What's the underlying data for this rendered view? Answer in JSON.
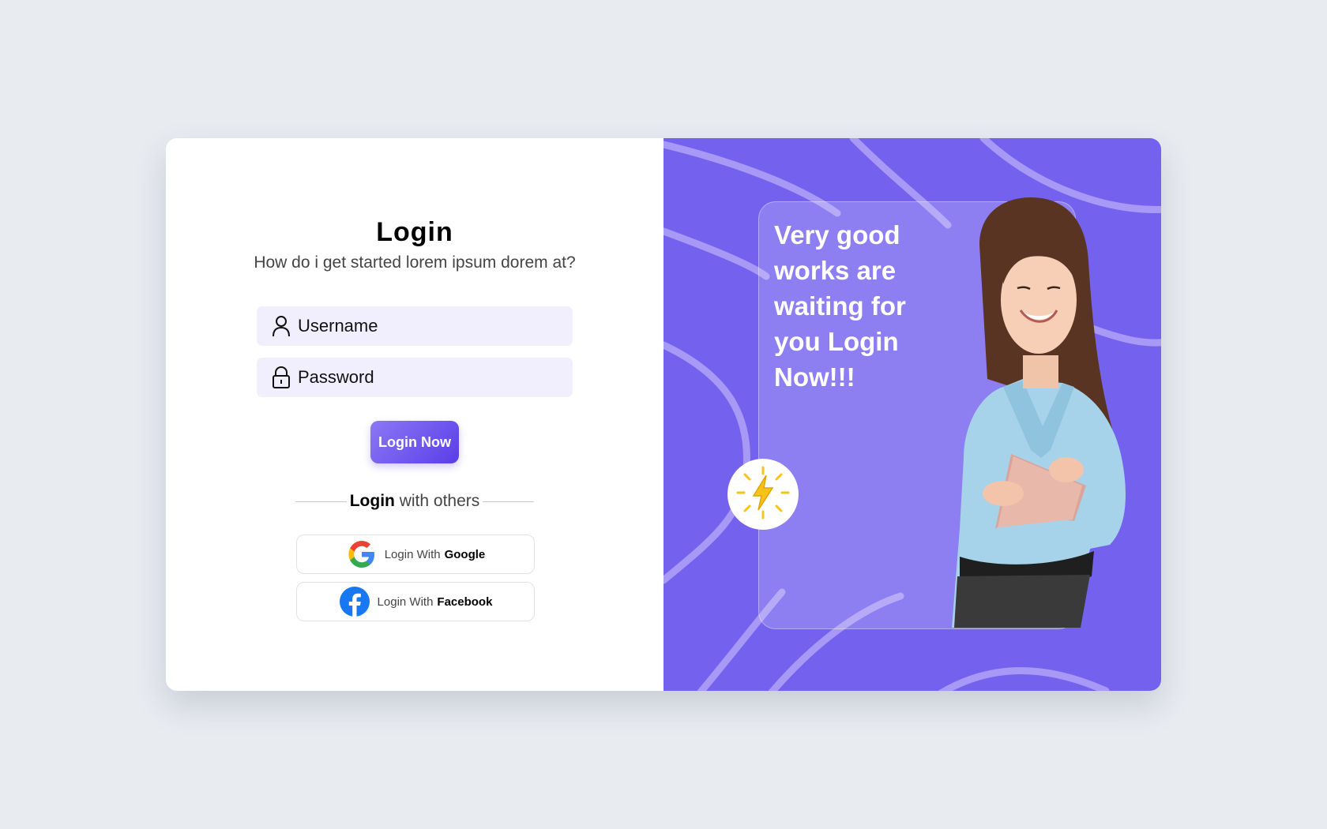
{
  "login": {
    "title": "Login",
    "subtitle": "How do i get started lorem ipsum dorem at?",
    "username_label": "Username",
    "password_label": "Password",
    "submit_label": "Login Now",
    "divider_bold": "Login",
    "divider_text": " with others",
    "google": {
      "prefix": "Login With",
      "provider": "Google"
    },
    "facebook": {
      "prefix": "Login With",
      "provider": "Facebook"
    }
  },
  "promo": {
    "headline": "Very good\nworks are\nwaiting for\nyou Login\nNow!!!"
  },
  "colors": {
    "accent": "#7462ef",
    "field_bg": "#f1effe",
    "page_bg": "#e8ebf0"
  },
  "icons": [
    "user-icon",
    "lock-icon",
    "google-icon",
    "facebook-icon",
    "lightning-icon"
  ]
}
